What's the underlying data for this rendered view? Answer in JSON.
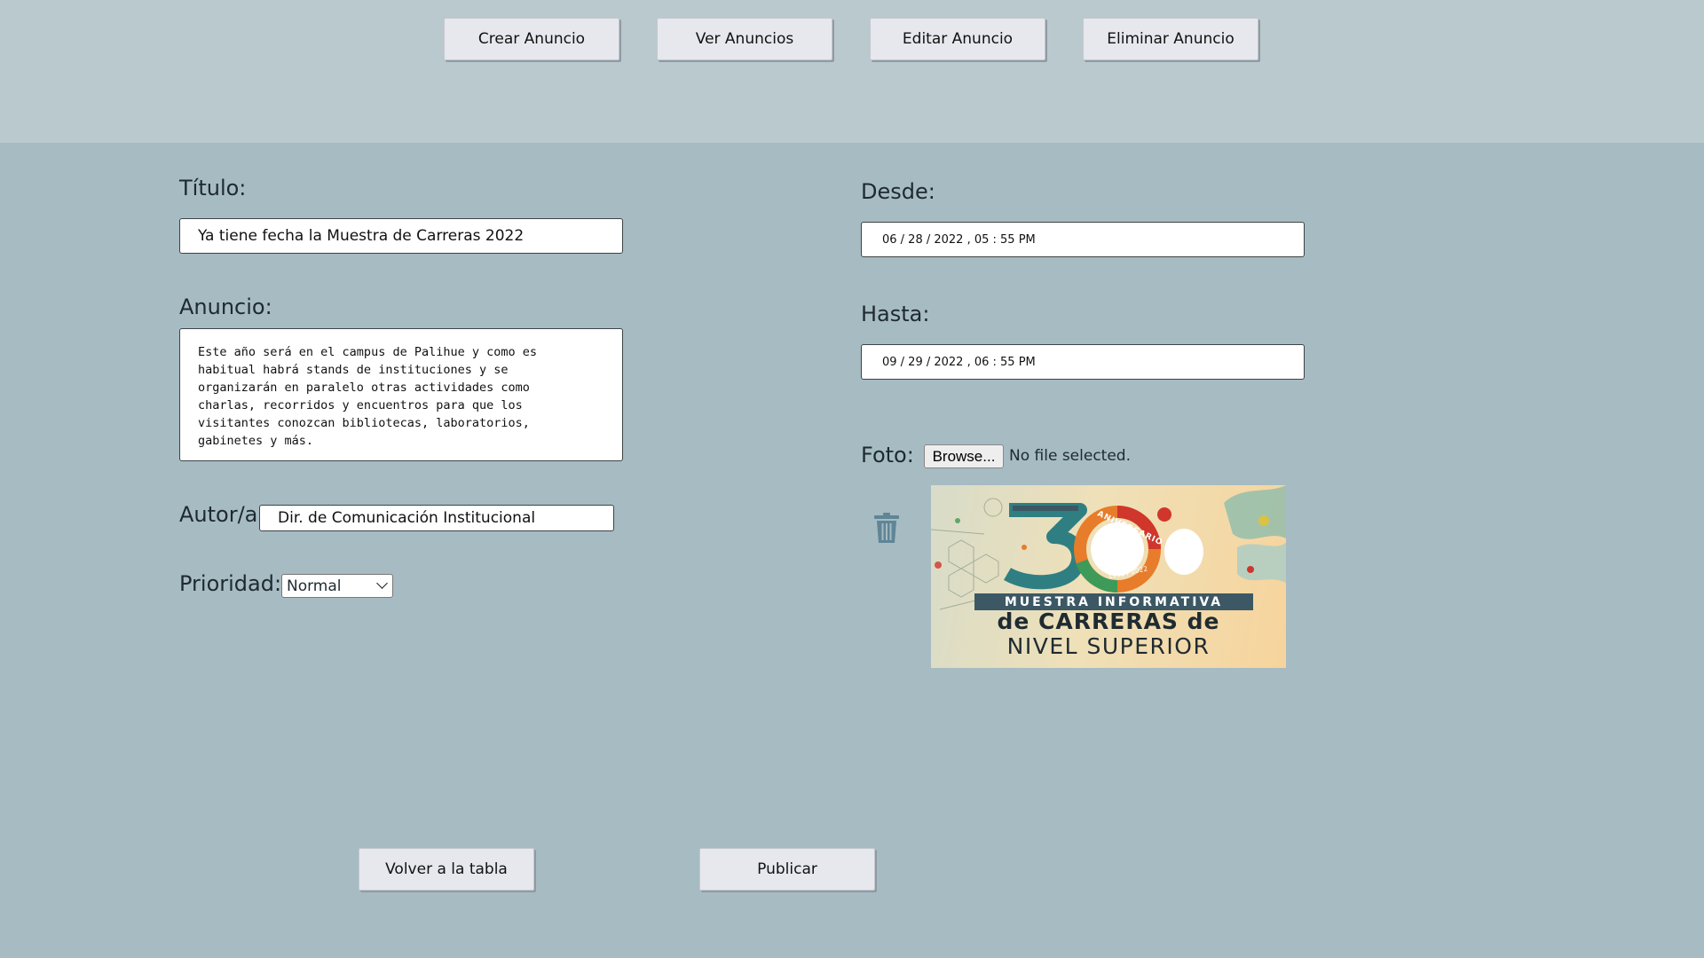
{
  "nav": {
    "create_label": "Crear Anuncio",
    "view_label": "Ver Anuncios",
    "edit_label": "Editar Anuncio",
    "delete_label": "Eliminar Anuncio"
  },
  "form": {
    "title_label": "Título:",
    "title_value": "Ya tiene fecha la Muestra de Carreras 2022",
    "announcement_label": "Anuncio:",
    "announcement_value": "Este año será en el campus de Palihue y como es\nhabitual habrá stands de instituciones y se\norganizarán en paralelo otras actividades como\ncharlas, recorridos y encuentros para que los\nvisitantes conozcan bibliotecas, laboratorios,\ngabinetes y más.",
    "author_label": "Autor/a:",
    "author_value": "Dir. de Comunicación Institucional",
    "priority_label": "Prioridad:",
    "priority_value": "Normal",
    "from_label": "Desde:",
    "from_value": "06 / 28 / 2022 ,  05 : 55   PM",
    "to_label": "Hasta:",
    "to_value": "09 / 29 / 2022 ,  06 : 55   PM",
    "photo_label": "Foto:",
    "browse_label": "Browse...",
    "file_status": "No file selected.",
    "delete_photo_icon": "trash-icon"
  },
  "poster": {
    "anniversary_text": "ANIVERSARIO",
    "years_text": "1992 / 2022",
    "band_text": "MUESTRA INFORMATIVA",
    "line1": "de CARRERAS de",
    "line2": "NIVEL SUPERIOR",
    "colors": {
      "teal": "#2f7f82",
      "orange": "#e77c2a",
      "red": "#d0362b",
      "green": "#3e9a58",
      "dark": "#3c5864"
    }
  },
  "actions": {
    "back_label": "Volver a la tabla",
    "publish_label": "Publicar"
  },
  "colors": {
    "page_bg": "#a7bbc3",
    "topbar_bg": "#b9c9ce",
    "button_bg": "#e7e8ee",
    "trash_icon": "#5f8596"
  }
}
